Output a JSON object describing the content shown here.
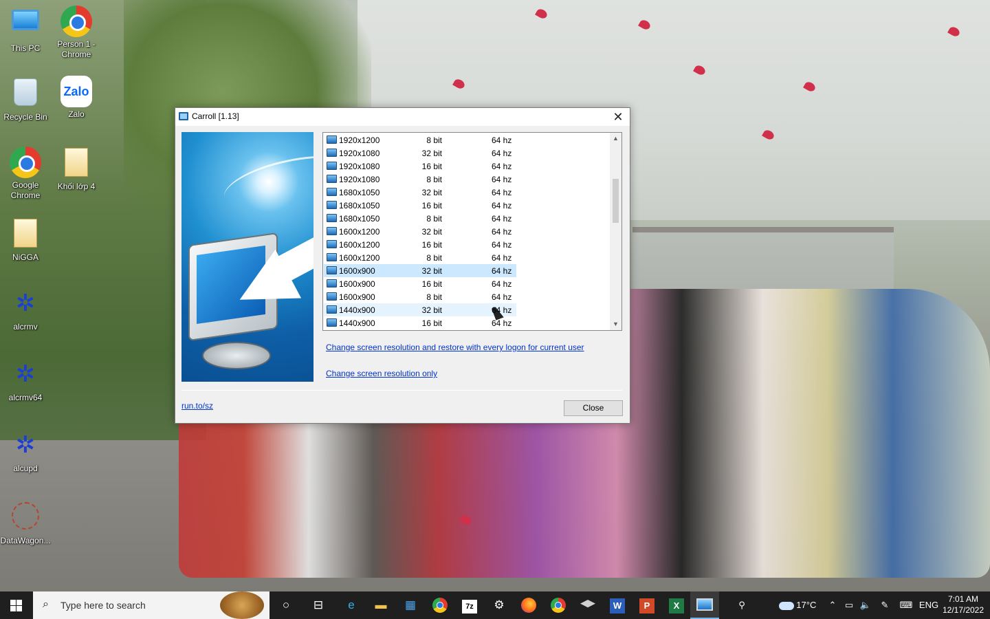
{
  "desktop": {
    "icons": [
      {
        "label": "This PC",
        "icon": "computer-icon"
      },
      {
        "label": "Person 1 - Chrome",
        "icon": "chrome-icon"
      },
      {
        "label": "Recycle Bin",
        "icon": "recycle-bin-icon"
      },
      {
        "label": "Zalo",
        "icon": "zalo-icon",
        "glyph": "Zalo"
      },
      {
        "label": "Google Chrome",
        "icon": "chrome-icon"
      },
      {
        "label": "Khối lớp 4",
        "icon": "folder-icon"
      },
      {
        "label": "NiGGA",
        "icon": "folder-icon"
      },
      {
        "label": "alcrmv",
        "icon": "realtek-crab-icon"
      },
      {
        "label": "alcrmv64",
        "icon": "realtek-crab-icon"
      },
      {
        "label": "alcupd",
        "icon": "realtek-crab-icon"
      },
      {
        "label": "DataWagon...",
        "icon": "web-icon"
      }
    ]
  },
  "dialog": {
    "title": "Carroll [1.13]",
    "close_glyph": "✕",
    "resolutions": [
      {
        "res": "1920x1200",
        "bit": "8 bit",
        "hz": "64 hz"
      },
      {
        "res": "1920x1080",
        "bit": "32 bit",
        "hz": "64 hz"
      },
      {
        "res": "1920x1080",
        "bit": "16 bit",
        "hz": "64 hz"
      },
      {
        "res": "1920x1080",
        "bit": "8 bit",
        "hz": "64 hz"
      },
      {
        "res": "1680x1050",
        "bit": "32 bit",
        "hz": "64 hz"
      },
      {
        "res": "1680x1050",
        "bit": "16 bit",
        "hz": "64 hz"
      },
      {
        "res": "1680x1050",
        "bit": "8 bit",
        "hz": "64 hz"
      },
      {
        "res": "1600x1200",
        "bit": "32 bit",
        "hz": "64 hz"
      },
      {
        "res": "1600x1200",
        "bit": "16 bit",
        "hz": "64 hz"
      },
      {
        "res": "1600x1200",
        "bit": "8 bit",
        "hz": "64 hz"
      },
      {
        "res": "1600x900",
        "bit": "32 bit",
        "hz": "64 hz",
        "state": "selected"
      },
      {
        "res": "1600x900",
        "bit": "16 bit",
        "hz": "64 hz"
      },
      {
        "res": "1600x900",
        "bit": "8 bit",
        "hz": "64 hz"
      },
      {
        "res": "1440x900",
        "bit": "32 bit",
        "hz": "64 hz",
        "state": "hover"
      },
      {
        "res": "1440x900",
        "bit": "16 bit",
        "hz": "64 hz"
      }
    ],
    "scroll_up": "▲",
    "scroll_down": "▼",
    "link_restore": "Change screen resolution and restore with every logon for current user",
    "link_only": "Change screen resolution only",
    "link_site": "run.to/sz",
    "close_button": "Close"
  },
  "taskbar": {
    "search_placeholder": "Type here to search",
    "search_glyph": "⌕",
    "cortana_glyph": "○",
    "taskview_glyph": "⊟",
    "edge_glyph": "e",
    "folder_glyph": "▬",
    "store_glyph": "▦",
    "sevenzip_label": "7z",
    "settings_glyph": "⚙",
    "word_label": "W",
    "ppt_label": "P",
    "excel_label": "X",
    "people_glyph": "⚲",
    "temperature": "17°C",
    "tray_chevron": "⌃",
    "network_glyph": "▭",
    "volume_glyph": "🔈",
    "pen_glyph": "✎",
    "keyboard_glyph": "⌨",
    "language": "ENG",
    "time": "7:01 AM",
    "date": "12/17/2022"
  },
  "colors": {
    "selection": "#cce8ff",
    "hover": "#e5f3ff",
    "link": "#0033cc",
    "taskbar": "#1f1f1f"
  }
}
